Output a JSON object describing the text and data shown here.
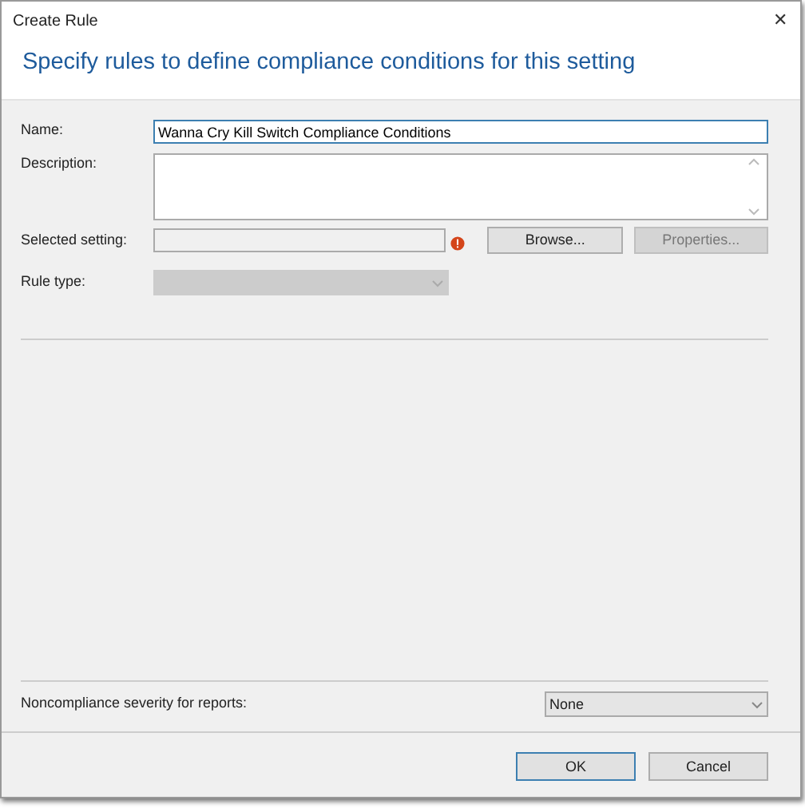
{
  "window": {
    "title": "Create Rule",
    "close": "✕"
  },
  "header": "Specify rules to define compliance conditions for this setting",
  "form": {
    "name_label": "Name:",
    "name_value": "Wanna Cry Kill Switch Compliance Conditions",
    "description_label": "Description:",
    "setting_label": "Selected setting:",
    "setting_error": true,
    "browse_button": {
      "label": "Browse...",
      "disabled": false
    },
    "properties_button": {
      "label": "Properties...",
      "disabled": true
    },
    "rule_type_label": "Rule type:",
    "rule_type_disabled": true
  },
  "severity": {
    "label": "Noncompliance severity for reports:",
    "value": "None"
  },
  "buttons": [
    {
      "label": "OK",
      "default": true
    },
    {
      "label": "Cancel",
      "default": false
    }
  ]
}
